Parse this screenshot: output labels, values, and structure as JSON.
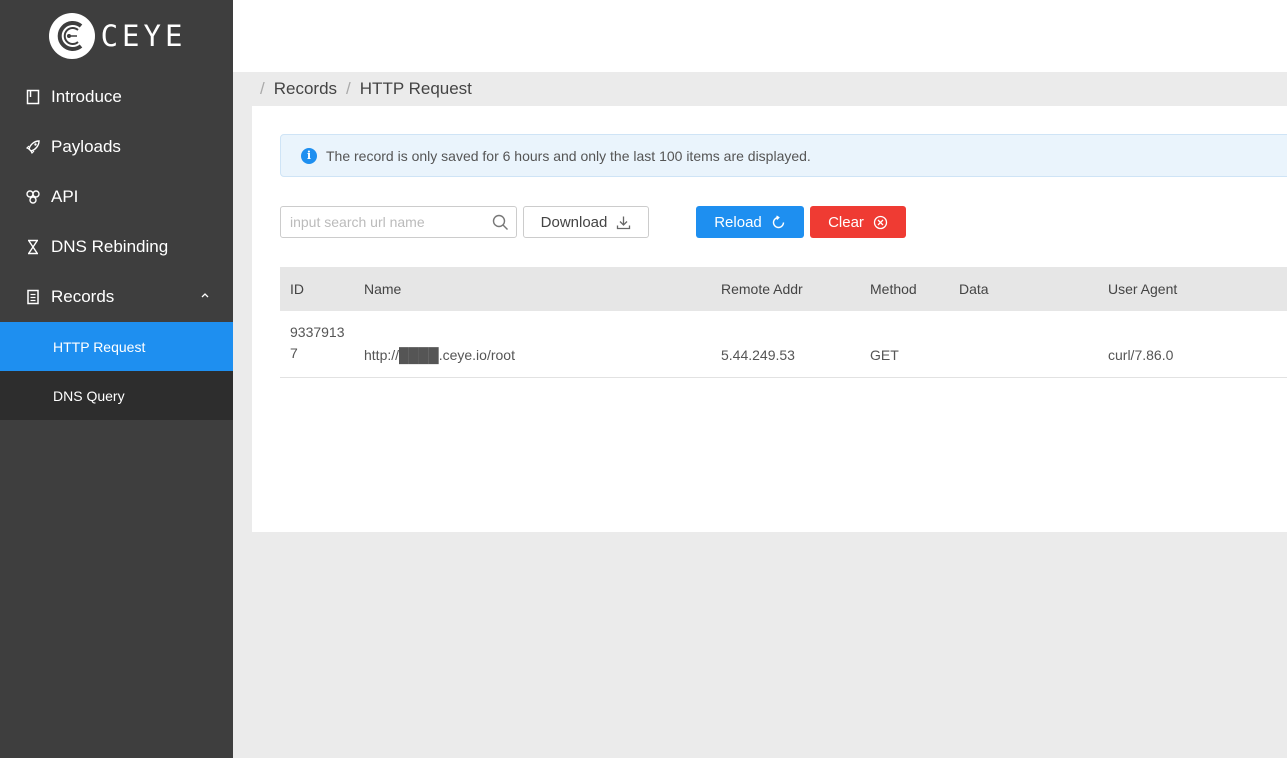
{
  "app": {
    "logo_text": "CEYE"
  },
  "sidebar": {
    "items": [
      {
        "label": "Introduce",
        "icon": "book-icon"
      },
      {
        "label": "Payloads",
        "icon": "rocket-icon"
      },
      {
        "label": "API",
        "icon": "api-icon"
      },
      {
        "label": "DNS Rebinding",
        "icon": "hourglass-icon"
      },
      {
        "label": "Records",
        "icon": "file-icon",
        "expanded": true
      }
    ],
    "subitems": [
      {
        "label": "HTTP Request",
        "active": true
      },
      {
        "label": "DNS Query",
        "active": false
      }
    ]
  },
  "breadcrumb": {
    "items": [
      "Records",
      "HTTP Request"
    ]
  },
  "alert": {
    "text": "The record is only saved for 6 hours and only the last 100 items are displayed."
  },
  "toolbar": {
    "search_placeholder": "input search url name",
    "download_label": "Download",
    "reload_label": "Reload",
    "clear_label": "Clear"
  },
  "table": {
    "headers": [
      "ID",
      "Name",
      "Remote Addr",
      "Method",
      "Data",
      "User Agent"
    ],
    "rows": [
      {
        "id_line1": "9337913",
        "id_line2": "7",
        "name": "http://████.ceye.io/root",
        "remote_addr": "5.44.249.53",
        "method": "GET",
        "data": "",
        "user_agent": "curl/7.86.0"
      }
    ]
  },
  "colors": {
    "sidebar_bg": "#3e3e3e",
    "active_item": "#1e8ff0",
    "reload_button": "#1e8ff0",
    "clear_button": "#ef3b33",
    "alert_bg": "#eaf4fc"
  }
}
